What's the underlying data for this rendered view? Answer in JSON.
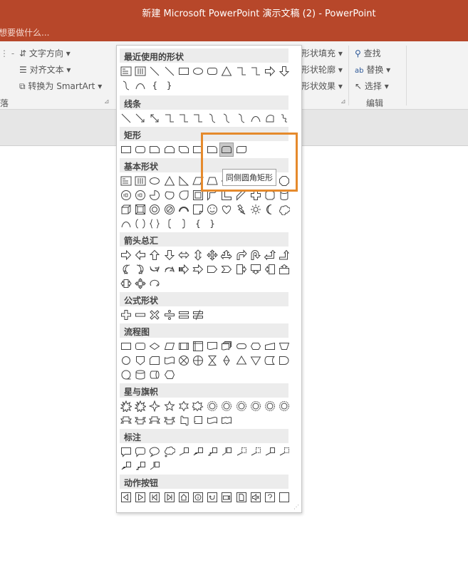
{
  "app": {
    "title": "新建 Microsoft PowerPoint 演示文稿 (2) - PowerPoint",
    "tell_me": "想要做什么..."
  },
  "ribbon": {
    "text_direction": "文字方向",
    "align_text": "对齐文本",
    "convert_smartart": "转换为 SmartArt",
    "paragraph_group": "落",
    "shape_fill": "形状填充",
    "shape_outline": "形状轮廓",
    "shape_effects": "形状效果",
    "find": "查找",
    "replace": "替换",
    "select": "选择",
    "editing_group": "编辑"
  },
  "panel": {
    "sections": [
      {
        "key": "recent",
        "label": "最近使用的形状"
      },
      {
        "key": "lines",
        "label": "线条"
      },
      {
        "key": "rect",
        "label": "矩形"
      },
      {
        "key": "basic",
        "label": "基本形状"
      },
      {
        "key": "arrows",
        "label": "箭头总汇"
      },
      {
        "key": "equation",
        "label": "公式形状"
      },
      {
        "key": "flowchart",
        "label": "流程图"
      },
      {
        "key": "stars",
        "label": "星与旗帜"
      },
      {
        "key": "callouts",
        "label": "标注"
      },
      {
        "key": "action",
        "label": "动作按钮"
      }
    ],
    "tooltip": "同侧圆角矩形",
    "selected_shape": "round-same-side-rectangle",
    "brace_left": "{",
    "brace_right": "}"
  },
  "colors": {
    "titlebar": "#b7472a",
    "highlight": "#e58a2c"
  }
}
